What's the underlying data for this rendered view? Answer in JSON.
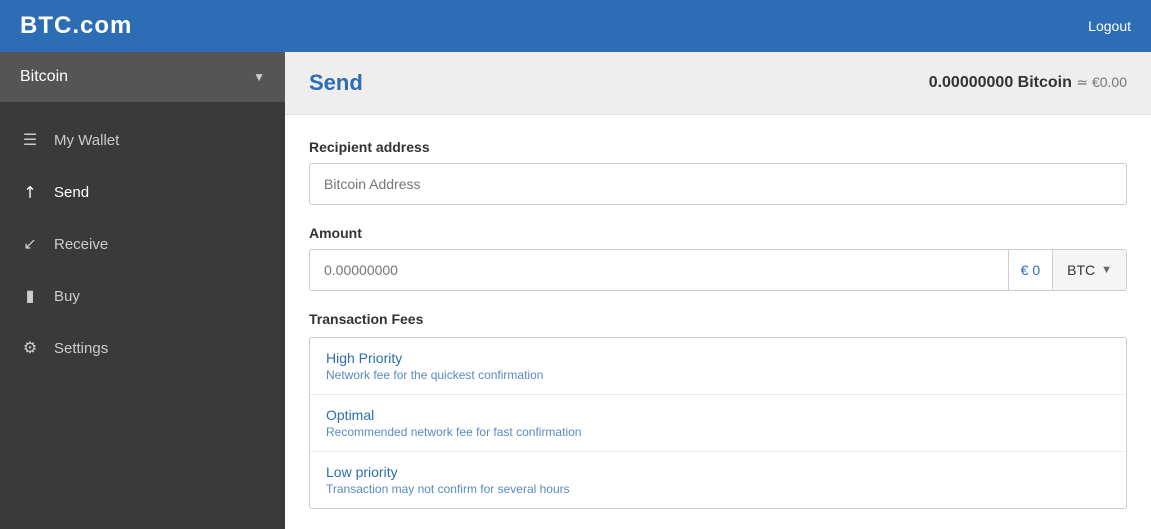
{
  "header": {
    "logo": "BTC.com",
    "logout_label": "Logout"
  },
  "sidebar": {
    "dropdown": {
      "label": "Bitcoin",
      "chevron": "▼"
    },
    "items": [
      {
        "id": "my-wallet",
        "label": "My Wallet",
        "icon": "☰"
      },
      {
        "id": "send",
        "label": "Send",
        "icon": "↗"
      },
      {
        "id": "receive",
        "label": "Receive",
        "icon": "↙"
      },
      {
        "id": "buy",
        "label": "Buy",
        "icon": "▬"
      },
      {
        "id": "settings",
        "label": "Settings",
        "icon": "⚙"
      }
    ]
  },
  "content": {
    "send_title": "Send",
    "balance_btc": "0.00000000 Bitcoin",
    "balance_approx": "≃ €0.00",
    "recipient_label": "Recipient address",
    "recipient_placeholder": "Bitcoin Address",
    "amount_label": "Amount",
    "amount_placeholder": "0.00000000",
    "amount_euro_label": "€ 0",
    "amount_currency": "BTC",
    "amount_chevron": "▼",
    "fees_label": "Transaction Fees",
    "fees": [
      {
        "title": "High Priority",
        "description": "Network fee for the quickest confirmation"
      },
      {
        "title": "Optimal",
        "description": "Recommended network fee for fast confirmation"
      },
      {
        "title": "Low priority",
        "description": "Transaction may not confirm for several hours"
      }
    ]
  }
}
